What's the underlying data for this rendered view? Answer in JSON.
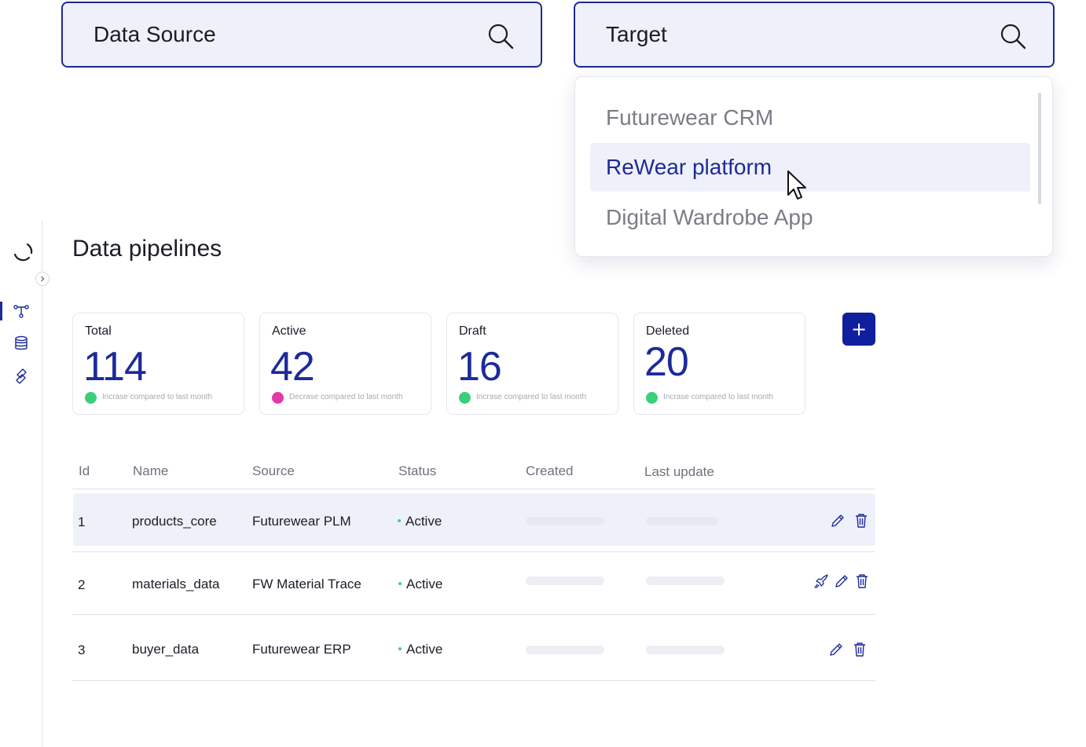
{
  "search": {
    "data_source_label": "Data Source",
    "target_label": "Target"
  },
  "dropdown": {
    "options": [
      {
        "label": "Futurewear CRM",
        "selected": false
      },
      {
        "label": "ReWear platform",
        "selected": true
      },
      {
        "label": "Digital Wardrobe App",
        "selected": false
      }
    ]
  },
  "page": {
    "title": "Data pipelines"
  },
  "stats": [
    {
      "label": "Total",
      "value": "114",
      "trend": "Incrase compared to last month",
      "trend_color": "#3ccf7a"
    },
    {
      "label": "Active",
      "value": "42",
      "trend": "Decrase compared to last month",
      "trend_color": "#e23aa6"
    },
    {
      "label": "Draft",
      "value": "16",
      "trend": "Incrase compared to last month",
      "trend_color": "#3ccf7a"
    },
    {
      "label": "Deleted",
      "value": "20",
      "trend": "Incrase compared to last month",
      "trend_color": "#3ccf7a"
    }
  ],
  "add_button": {
    "label": "+"
  },
  "table": {
    "headers": [
      "Id",
      "Name",
      "Source",
      "Status",
      "Created",
      "Last update"
    ],
    "rows": [
      {
        "id": "1",
        "name": "products_core",
        "source": "Futurewear PLM",
        "status": "Active"
      },
      {
        "id": "2",
        "name": "materials_data",
        "source": "FW Material Trace",
        "status": "Active"
      },
      {
        "id": "3",
        "name": "buyer_data",
        "source": "Futurewear ERP",
        "status": "Active"
      }
    ]
  },
  "colors": {
    "accent": "#1d2a9a",
    "button": "#0f1f9e",
    "highlight": "#eef1fa",
    "status_active": "#3ccf9a"
  },
  "icons": {
    "search": "search-icon",
    "pipeline": "pipeline-icon",
    "database": "database-icon",
    "transform": "transform-icon",
    "edit": "pencil-icon",
    "delete": "trash-icon",
    "deploy": "rocket-icon"
  }
}
